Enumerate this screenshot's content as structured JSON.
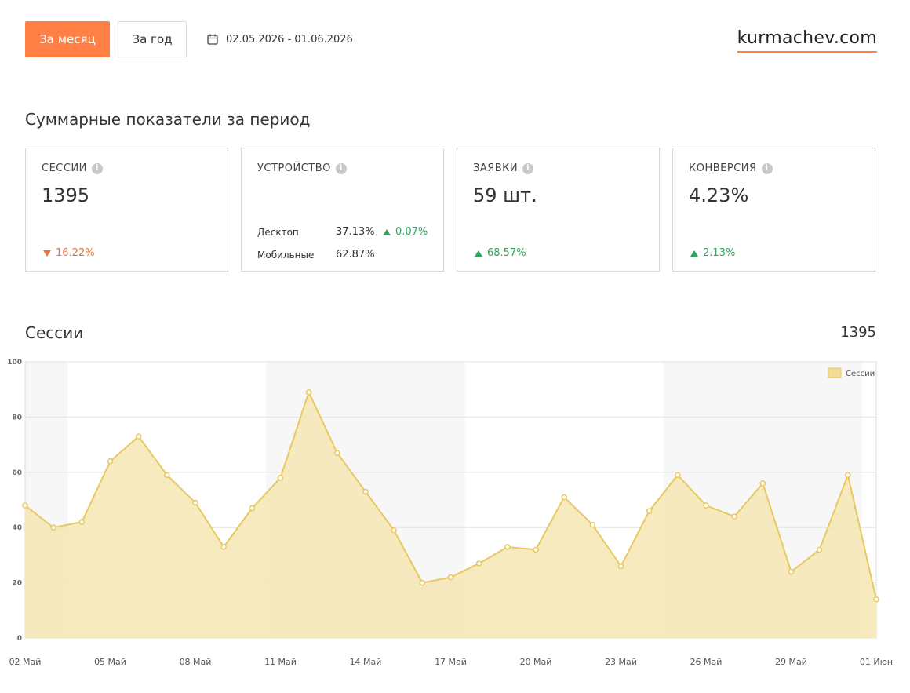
{
  "header": {
    "btn_month": "За месяц",
    "btn_year": "За год",
    "date_range": "02.05.2026 - 01.06.2026",
    "brand": "kurmachev.com"
  },
  "summary": {
    "title": "Суммарные показатели за период",
    "sessions": {
      "label": "СЕССИИ",
      "value": "1395",
      "delta": "16.22%",
      "direction": "down"
    },
    "device": {
      "label": "УСТРОЙСТВО",
      "desktop": {
        "name": "Десктоп",
        "pct": "37.13%",
        "delta": "0.07%",
        "direction": "up"
      },
      "mobile": {
        "name": "Мобильные",
        "pct": "62.87%"
      }
    },
    "leads": {
      "label": "ЗАЯВКИ",
      "value": "59 шт.",
      "delta": "68.57%",
      "direction": "up"
    },
    "conversion": {
      "label": "КОНВЕРСИЯ",
      "value": "4.23%",
      "delta": "2.13%",
      "direction": "up"
    }
  },
  "chart_section": {
    "title": "Сессии",
    "total": "1395"
  },
  "colors": {
    "accent": "#ff7f45",
    "up": "#2fa55b",
    "down": "#e8743b",
    "line": "#e8c860",
    "fill": "#f7e6b4"
  },
  "chart_data": {
    "type": "area",
    "ylim": [
      0,
      100
    ],
    "yticks": [
      0,
      20,
      40,
      60,
      80,
      100
    ],
    "grid": true,
    "legend_position": "top-right",
    "series": [
      {
        "name": "Сессии",
        "values": [
          48,
          40,
          42,
          64,
          73,
          59,
          49,
          33,
          47,
          58,
          89,
          67,
          53,
          39,
          20,
          22,
          27,
          33,
          32,
          51,
          41,
          26,
          46,
          59,
          48,
          44,
          56,
          24,
          32,
          59,
          14
        ]
      }
    ],
    "x": [
      "02 Май",
      "03 Май",
      "04 Май",
      "05 Май",
      "06 Май",
      "07 Май",
      "08 Май",
      "09 Май",
      "10 Май",
      "11 Май",
      "12 Май",
      "13 Май",
      "14 Май",
      "15 Май",
      "16 Май",
      "17 Май",
      "18 Май",
      "19 Май",
      "20 Май",
      "21 Май",
      "22 Май",
      "23 Май",
      "24 Май",
      "25 Май",
      "26 Май",
      "27 Май",
      "28 Май",
      "29 Май",
      "30 Май",
      "31 Май",
      "01 Июн"
    ],
    "xtick_labels": [
      "02 Май",
      "05 Май",
      "08 Май",
      "11 Май",
      "14 Май",
      "17 Май",
      "20 Май",
      "23 Май",
      "26 Май",
      "29 Май",
      "01 Июн"
    ]
  }
}
